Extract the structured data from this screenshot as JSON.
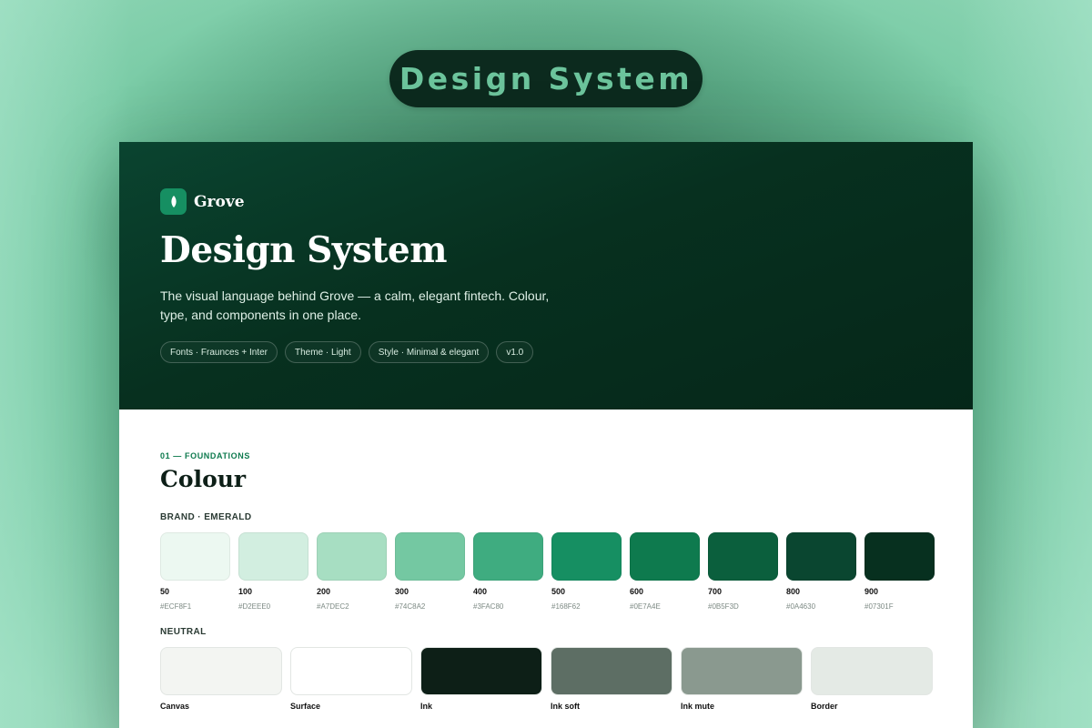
{
  "banner": {
    "title": "Design System"
  },
  "brand": {
    "name": "Grove"
  },
  "hero": {
    "title": "Design System",
    "description": "The visual language behind Grove — a calm, elegant fintech. Colour, type, and components in one place.",
    "tags": [
      "Fonts · Fraunces + Inter",
      "Theme · Light",
      "Style · Minimal & elegant",
      "v1.0"
    ]
  },
  "section": {
    "eyebrow": "01 — FOUNDATIONS",
    "title": "Colour"
  },
  "brand_palette": {
    "label": "BRAND · EMERALD",
    "swatches": [
      {
        "step": "50",
        "hex": "#ECF8F1"
      },
      {
        "step": "100",
        "hex": "#D2EEE0"
      },
      {
        "step": "200",
        "hex": "#A7DEC2"
      },
      {
        "step": "300",
        "hex": "#74C8A2"
      },
      {
        "step": "400",
        "hex": "#3FAC80"
      },
      {
        "step": "500",
        "hex": "#168F62"
      },
      {
        "step": "600",
        "hex": "#0E7A4E"
      },
      {
        "step": "700",
        "hex": "#0B5F3D"
      },
      {
        "step": "800",
        "hex": "#0A4630"
      },
      {
        "step": "900",
        "hex": "#07301F"
      }
    ]
  },
  "neutral_palette": {
    "label": "NEUTRAL",
    "swatches": [
      {
        "name": "Canvas",
        "color": "#F3F5F2"
      },
      {
        "name": "Surface",
        "color": "#FFFFFF"
      },
      {
        "name": "Ink",
        "color": "#0D1F17"
      },
      {
        "name": "Ink soft",
        "color": "#5D6E64"
      },
      {
        "name": "Ink mute",
        "color": "#8A998F"
      },
      {
        "name": "Border",
        "color": "#E4EAE5"
      }
    ]
  }
}
